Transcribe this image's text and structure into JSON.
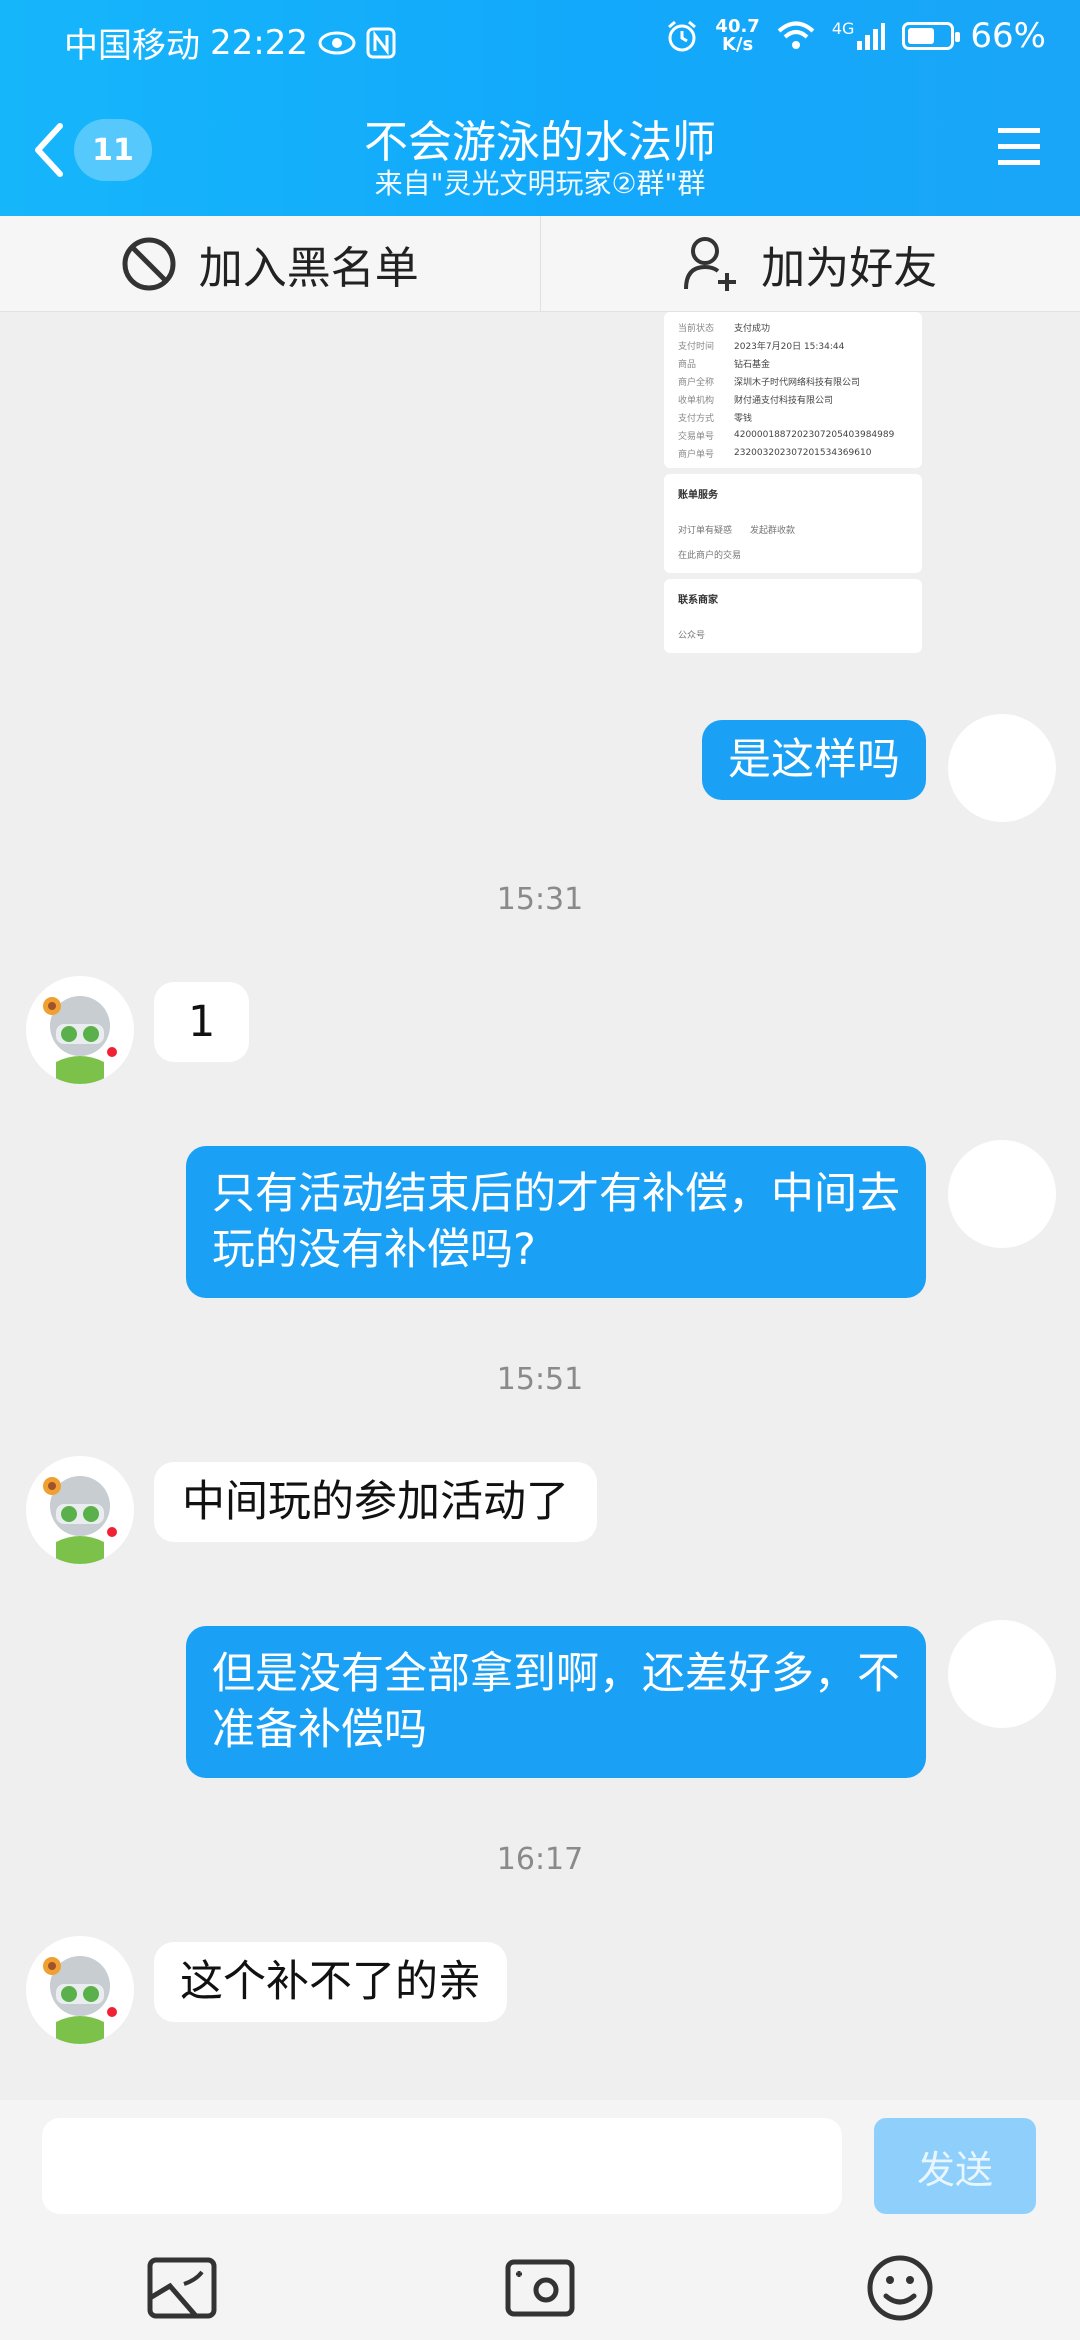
{
  "status_bar": {
    "carrier": "中国移动",
    "time": "22:22",
    "net_speed_value": "40.7",
    "net_speed_unit": "K/s",
    "signal_type": "4G",
    "battery_percent_label": "66%",
    "battery_level": 0.66
  },
  "header": {
    "unread_count": "11",
    "title": "不会游泳的水法师",
    "subtitle": "来自\"灵光文明玩家②群\"群"
  },
  "actions": {
    "block_label": "加入黑名单",
    "add_friend_label": "加为好友"
  },
  "receipt": {
    "rows": [
      {
        "k": "当前状态",
        "v": "支付成功"
      },
      {
        "k": "支付时间",
        "v": "2023年7月20日 15:34:44"
      },
      {
        "k": "商品",
        "v": "钻石基金"
      },
      {
        "k": "商户全称",
        "v": "深圳木子时代网络科技有限公司"
      },
      {
        "k": "收单机构",
        "v": "财付通支付科技有限公司"
      },
      {
        "k": "支付方式",
        "v": "零钱"
      },
      {
        "k": "交易单号",
        "v": "4200001887202307205403984989"
      },
      {
        "k": "商户单号",
        "v": "23200320230720153436961​0"
      }
    ],
    "service_title": "账单服务",
    "service_link1": "对订单有疑惑",
    "service_link2": "发起群收款",
    "service_link3": "在此商户的交易",
    "contact_title": "联系商家",
    "contact_link": "公众号"
  },
  "messages": [
    {
      "from": "me",
      "text": "是这样吗"
    },
    {
      "time": "15:31"
    },
    {
      "from": "them",
      "text": "1"
    },
    {
      "from": "me",
      "text": "只有活动结束后的才有补偿，中间去玩的没有补偿吗?"
    },
    {
      "time": "15:51"
    },
    {
      "from": "them",
      "text": "中间玩的参加活动了"
    },
    {
      "from": "me",
      "text": "但是没有全部拿到啊，还差好多，不准备补偿吗"
    },
    {
      "time": "16:17"
    },
    {
      "from": "them",
      "text": "这个补不了的亲"
    }
  ],
  "input": {
    "value": "",
    "send_label": "发送"
  },
  "toolbar_icons": [
    "image-icon",
    "camera-icon",
    "emoji-icon"
  ],
  "colors": {
    "header": "#16b6fb",
    "my_bubble": "#1aa0f5",
    "send_button": "#8ed0fb"
  }
}
